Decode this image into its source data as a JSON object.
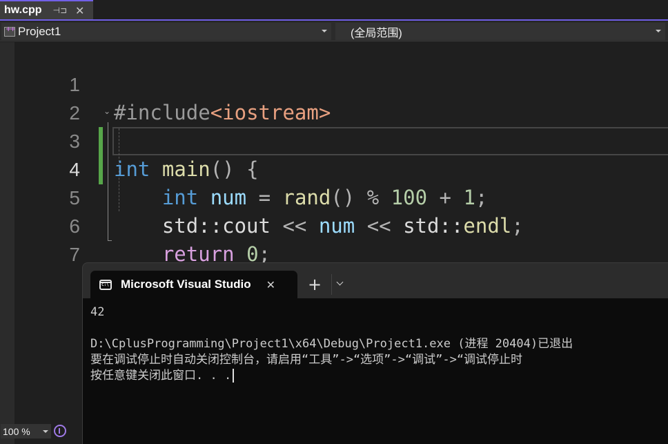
{
  "document_tab": {
    "title": "hw.cpp",
    "pin_icon": "pin-icon",
    "close_icon": "close-icon"
  },
  "navbar": {
    "project": "Project1",
    "scope": "(全局范围)"
  },
  "editor": {
    "active_line": 4,
    "line_numbers": [
      "1",
      "2",
      "3",
      "4",
      "5",
      "6",
      "7"
    ],
    "lines": {
      "l1": {
        "directive": "#include",
        "header": "<iostream>"
      },
      "l3": {
        "type": "int",
        "name": "main",
        "parens": "()",
        "brace": "{"
      },
      "l4": {
        "type": "int",
        "var": "num",
        "op_eq": "=",
        "call": "rand",
        "parens": "()",
        "op_mod": "%",
        "n100": "100",
        "op_plus": "+",
        "n1": "1",
        "semi": ";"
      },
      "l5": {
        "ns1": "std::cout",
        "op1": "<<",
        "var": "num",
        "op2": "<<",
        "ns2": "std::",
        "endl": "endl",
        "semi": ";"
      },
      "l6": {
        "kw": "return",
        "zero": "0",
        "semi": ";"
      },
      "l7": {
        "brace": "}"
      }
    }
  },
  "zoom": {
    "level": "100 %"
  },
  "terminal": {
    "tab_title": "Microsoft Visual Studio",
    "tab_icon": "cmd-icon",
    "new_tab_label": "+",
    "output": [
      "42",
      "",
      "D:\\CplusProgramming\\Project1\\x64\\Debug\\Project1.exe (进程 20404)已退出",
      "要在调试停止时自动关闭控制台，请启用“工具”->“选项”->“调试”->“调试停止时",
      "按任意键关闭此窗口. . ."
    ]
  }
}
